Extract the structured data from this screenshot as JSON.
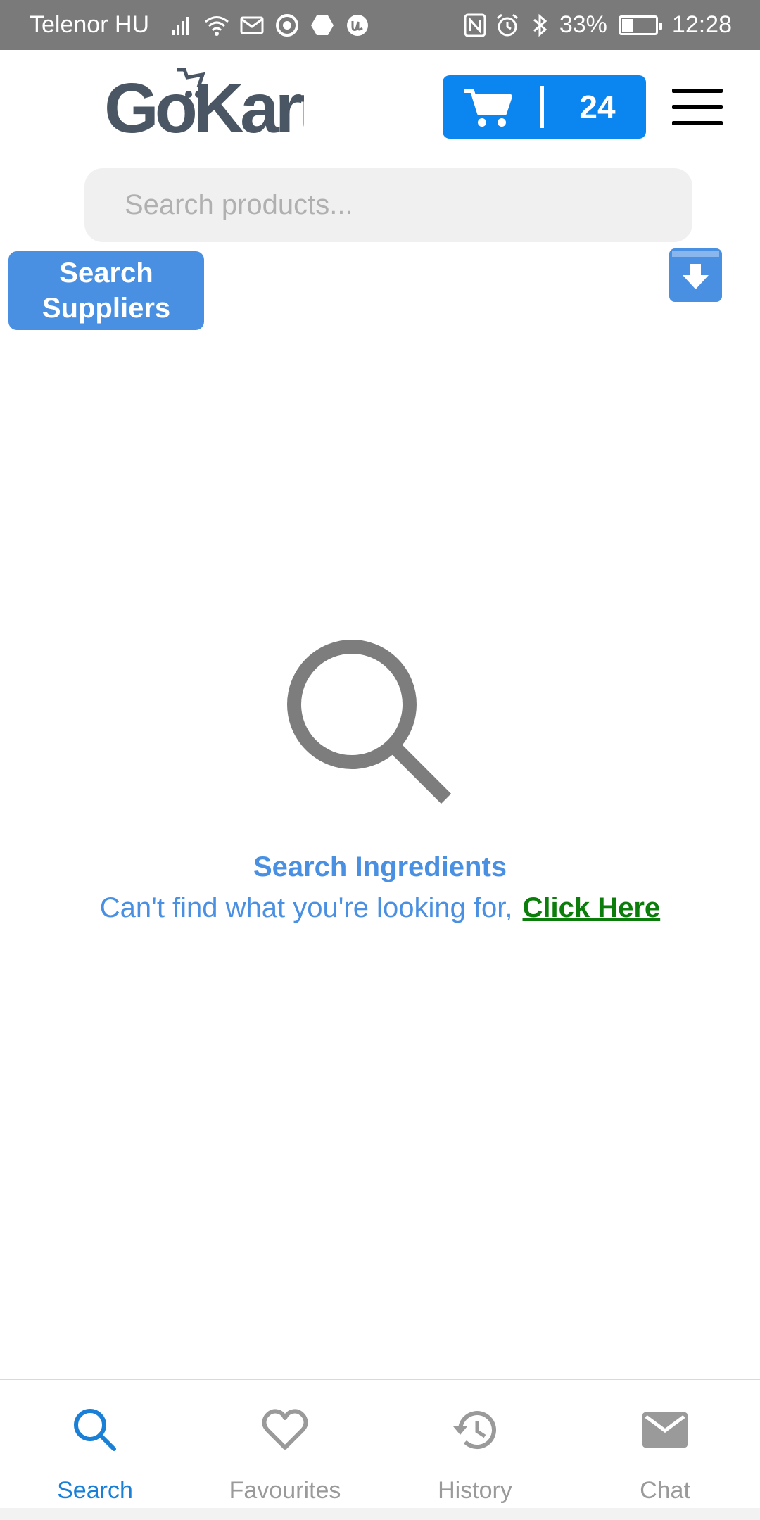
{
  "status_bar": {
    "carrier": "Telenor HU",
    "battery_percent": "33%",
    "battery_level": 0.33,
    "time": "12:28",
    "icons": [
      "signal-icon",
      "wifi-icon",
      "gmail-icon",
      "chrome-icon",
      "app-icon",
      "u-app-icon",
      "nfc-icon",
      "alarm-icon",
      "bluetooth-icon",
      "battery-icon"
    ]
  },
  "header": {
    "logo_text": "GoKart",
    "cart_count": "24",
    "cart_icon": "cart-icon",
    "menu_icon": "hamburger-icon"
  },
  "search": {
    "placeholder": "Search products..."
  },
  "actions": {
    "suppliers_label_line1": "Search",
    "suppliers_label_line2": "Suppliers",
    "archive_icon": "archive-download-icon"
  },
  "empty_state": {
    "icon": "search-icon",
    "title": "Search Ingredients",
    "message": "Can't find what you're looking for,",
    "link": "Click Here"
  },
  "bottom_nav": {
    "items": [
      {
        "label": "Search",
        "icon": "search-icon",
        "active": true
      },
      {
        "label": "Favourites",
        "icon": "heart-icon",
        "active": false
      },
      {
        "label": "History",
        "icon": "history-icon",
        "active": false
      },
      {
        "label": "Chat",
        "icon": "mail-icon",
        "active": false
      }
    ]
  },
  "colors": {
    "primary_blue": "#0b86f0",
    "button_blue": "#4a90e2",
    "link_green": "#0a7d0a",
    "status_bar": "#7a7a7a",
    "inactive_gray": "#9a9a9a"
  }
}
